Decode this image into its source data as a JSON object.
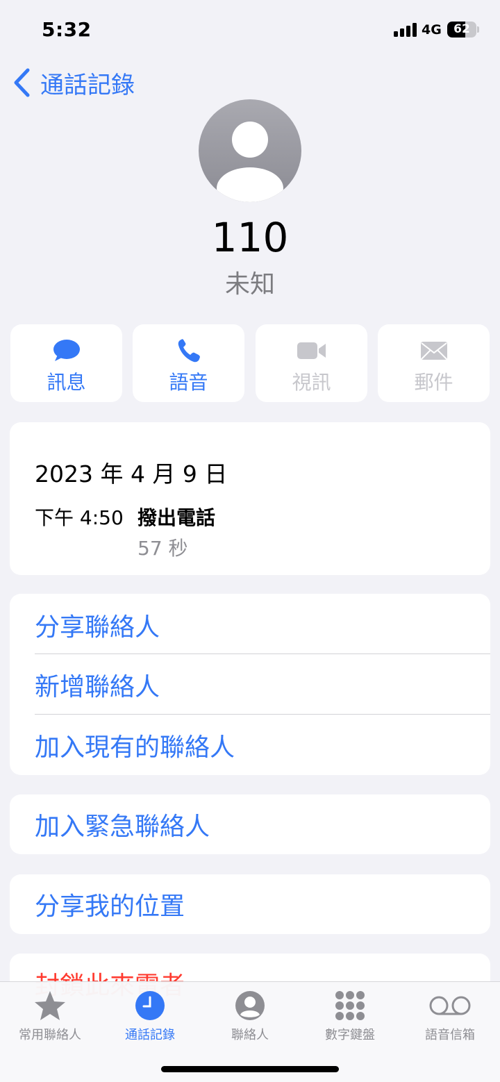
{
  "status_bar": {
    "time": "5:32",
    "network": "4G",
    "battery": "62",
    "battery_level": 0.62
  },
  "nav": {
    "back_label": "通話記錄"
  },
  "contact": {
    "number": "110",
    "label": "未知"
  },
  "actions": [
    {
      "label": "訊息",
      "icon": "message-bubble-icon",
      "enabled": true
    },
    {
      "label": "語音",
      "icon": "phone-icon",
      "enabled": true
    },
    {
      "label": "視訊",
      "icon": "video-camera-icon",
      "enabled": false
    },
    {
      "label": "郵件",
      "icon": "envelope-icon",
      "enabled": false
    }
  ],
  "call_log": {
    "date": "2023 年 4 月 9 日",
    "time": "下午 4:50",
    "type": "撥出電話",
    "duration": "57 秒"
  },
  "contact_options": [
    "分享聯絡人",
    "新增聯絡人",
    "加入現有的聯絡人"
  ],
  "emergency": {
    "label": "加入緊急聯絡人"
  },
  "location": {
    "label": "分享我的位置"
  },
  "block": {
    "label": "封鎖此來電者"
  },
  "tabs": [
    {
      "label": "常用聯絡人",
      "icon": "star-icon",
      "selected": false
    },
    {
      "label": "通話記錄",
      "icon": "clock-icon",
      "selected": true
    },
    {
      "label": "聯絡人",
      "icon": "person-circle-icon",
      "selected": false
    },
    {
      "label": "數字鍵盤",
      "icon": "keypad-icon",
      "selected": false
    },
    {
      "label": "語音信箱",
      "icon": "voicemail-icon",
      "selected": false
    }
  ],
  "colors": {
    "accent": "#3478f6",
    "destructive": "#ff3b30",
    "disabled": "#c7c7cc",
    "background": "#f2f2f7"
  }
}
